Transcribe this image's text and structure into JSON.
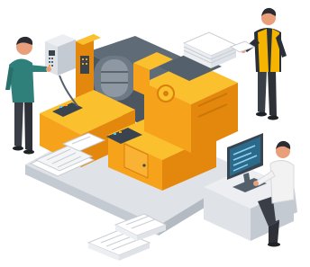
{
  "illustration": {
    "palette": {
      "printer_orange": "#f7a21b",
      "printer_orange_dark": "#e4870d",
      "printer_yellow": "#fbc02d",
      "machine_gray": "#54616d",
      "machine_dark": "#3a444e",
      "base_gray": "#dfe3e8",
      "base_shadow": "#c4cad1",
      "paper": "#f4f5f7",
      "paper_line": "#c9ced4",
      "screen_blue": "#2b6a8a",
      "shirt_teal": "#2f7f7a",
      "shirt_white": "#f2f2f2",
      "vest_yellow": "#f5b400",
      "pants_dark": "#3a3f47",
      "skin": "#e9a07a",
      "hair": "#2b2b33"
    },
    "icons": [
      "printing-press-icon",
      "operator-person-icon",
      "paper-carrier-person-icon",
      "computer-worker-person-icon",
      "paper-stack-icon",
      "control-panel-icon",
      "monitor-icon",
      "desk-icon"
    ]
  }
}
